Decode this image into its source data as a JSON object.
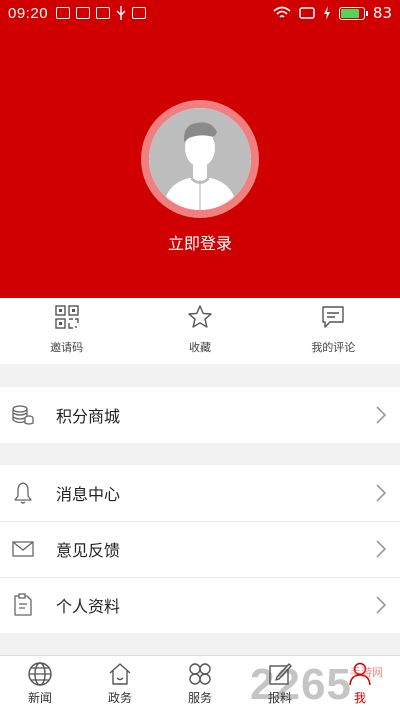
{
  "status_bar": {
    "time": "09:20",
    "battery_level": "83",
    "battery_fraction": 0.83
  },
  "profile": {
    "login_label": "立即登录"
  },
  "quick_actions": [
    {
      "label": "邀请码",
      "icon": "qr-code-icon"
    },
    {
      "label": "收藏",
      "icon": "star-icon"
    },
    {
      "label": "我的评论",
      "icon": "comment-icon"
    }
  ],
  "menu": {
    "group1": [
      {
        "label": "积分商城",
        "icon": "coins-icon"
      }
    ],
    "group2": [
      {
        "label": "消息中心",
        "icon": "bell-icon"
      },
      {
        "label": "意见反馈",
        "icon": "mail-icon"
      },
      {
        "label": "个人资料",
        "icon": "profile-doc-icon"
      }
    ]
  },
  "bottom_nav": [
    {
      "label": "新闻",
      "icon": "globe-icon"
    },
    {
      "label": "政务",
      "icon": "home-icon"
    },
    {
      "label": "服务",
      "icon": "grid-petals-icon"
    },
    {
      "label": "报料",
      "icon": "edit-icon"
    },
    {
      "label": "我",
      "icon": "user-icon",
      "active": true
    }
  ],
  "watermark": {
    "text": "2265",
    "sub": "手游网"
  },
  "colors": {
    "brand_red": "#d10000",
    "avatar_ring": "#f08080",
    "battery_green": "#52d45a"
  }
}
